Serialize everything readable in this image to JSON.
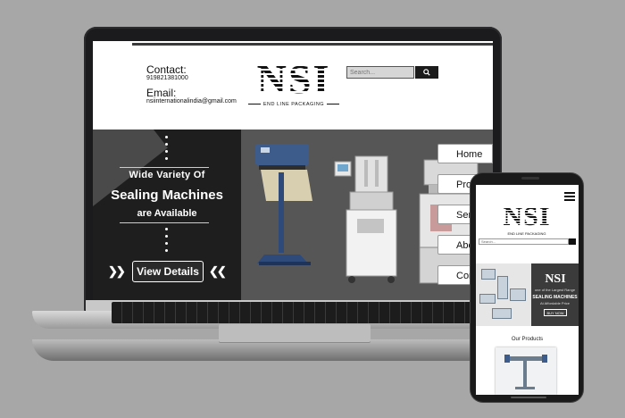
{
  "laptop_site": {
    "contact_label": "Contact:",
    "phone": "919821381000",
    "email_label": "Email:",
    "email": "nsiinternationalindia@gmail.com",
    "logo_text": "NSI",
    "logo_tagline": "END LINE PACKAGING",
    "search_placeholder": "Search...",
    "banner": {
      "line1": "Wide Variety Of",
      "line2": "Sealing Machines",
      "line3": "are Available",
      "cta": "View Details",
      "arrow_left": "❯❯",
      "arrow_right": "❮❮"
    },
    "nav": [
      "Home",
      "Produ",
      "Servi",
      "Abou",
      "Conta"
    ]
  },
  "phone_site": {
    "logo_text": "NSI",
    "logo_tagline": "END LINE PACKAGING",
    "search_placeholder": "Search...",
    "banner": {
      "logo": "NSI",
      "subtitle": "one of the Largest Range",
      "title": "SEALING MACHINES",
      "price_line": "At Affordable Price",
      "cta": "BUY NOW"
    },
    "section_title": "Our Products"
  },
  "colors": {
    "background": "#a7a7a7",
    "banner_dark": "#1e1e1e",
    "banner_grey": "#565656"
  }
}
